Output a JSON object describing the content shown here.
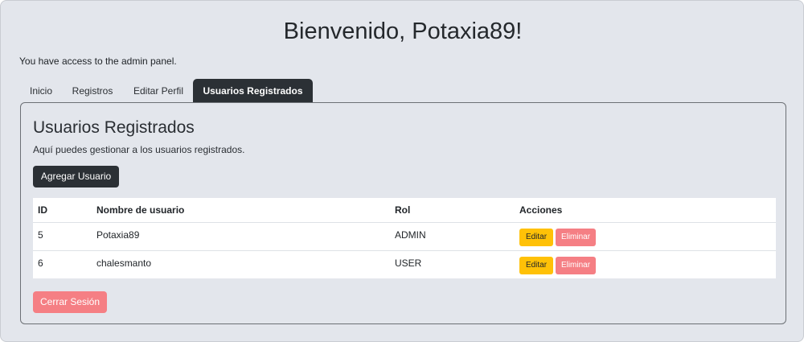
{
  "header": {
    "title": "Bienvenido, Potaxia89!",
    "access_text": "You have access to the admin panel."
  },
  "tabs": [
    {
      "label": "Inicio",
      "active": false
    },
    {
      "label": "Registros",
      "active": false
    },
    {
      "label": "Editar Perfil",
      "active": false
    },
    {
      "label": "Usuarios Registrados",
      "active": true
    }
  ],
  "panel": {
    "title": "Usuarios Registrados",
    "description": "Aquí puedes gestionar a los usuarios registrados.",
    "add_button": "Agregar Usuario",
    "logout_button": "Cerrar Sesión"
  },
  "table": {
    "columns": [
      "ID",
      "Nombre de usuario",
      "Rol",
      "Acciones"
    ],
    "rows": [
      {
        "id": "5",
        "username": "Potaxia89",
        "role": "ADMIN",
        "edit": "Editar",
        "delete": "Eliminar"
      },
      {
        "id": "6",
        "username": "chalesmanto",
        "role": "USER",
        "edit": "Editar",
        "delete": "Eliminar"
      }
    ]
  },
  "colors": {
    "background": "#e3e6ec",
    "dark": "#2b3035",
    "warning": "#ffc107",
    "danger_light": "#f57f84"
  }
}
